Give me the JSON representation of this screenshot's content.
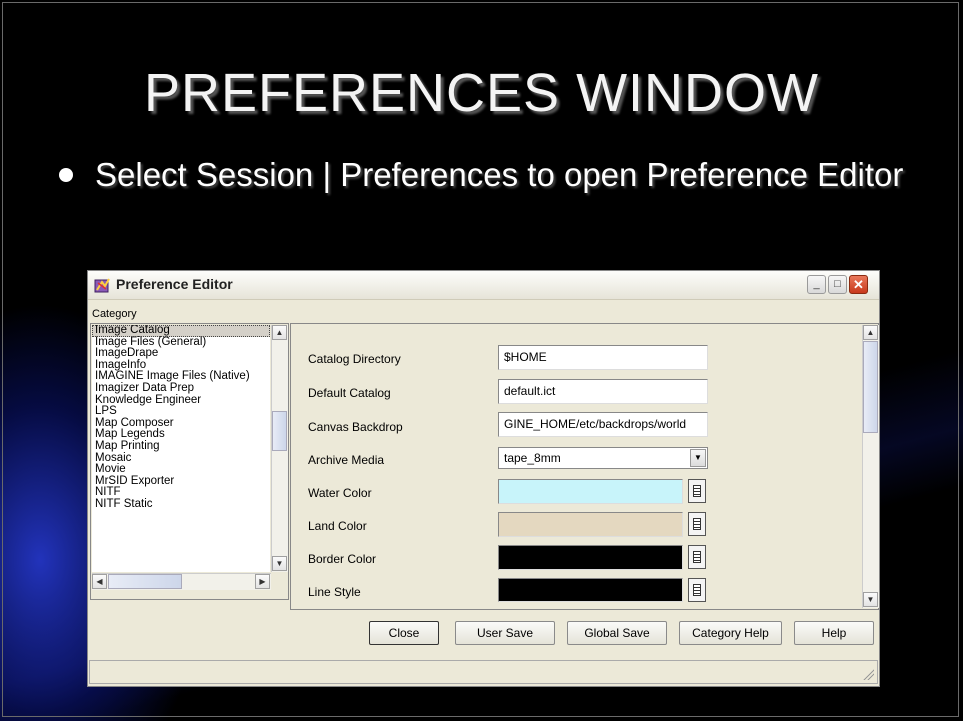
{
  "slide": {
    "title": "PREFERENCES WINDOW",
    "bullet": "Select Session | Preferences to open Preference Editor"
  },
  "window": {
    "title": "Preference Editor",
    "controls": {
      "minimize": "_",
      "maximize": "□",
      "close": "✕"
    }
  },
  "category": {
    "label": "Category",
    "selected": "Image Catalog",
    "items": [
      "Image Catalog",
      "Image Files (General)",
      "ImageDrape",
      "ImageInfo",
      "IMAGINE Image Files (Native)",
      "Imagizer Data Prep",
      "Knowledge Engineer",
      "LPS",
      "Map Composer",
      "Map Legends",
      "Map Printing",
      "Mosaic",
      "Movie",
      "MrSID Exporter",
      "NITF",
      "NITF Static"
    ]
  },
  "preferences": {
    "catalog_directory": {
      "label": "Catalog Directory",
      "value": "$HOME"
    },
    "default_catalog": {
      "label": "Default Catalog",
      "value": "default.ict"
    },
    "canvas_backdrop": {
      "label": "Canvas Backdrop",
      "value": "GINE_HOME/etc/backdrops/world"
    },
    "archive_media": {
      "label": "Archive Media",
      "value": "tape_8mm"
    },
    "water_color": {
      "label": "Water Color",
      "color": "#c8f4fa"
    },
    "land_color": {
      "label": "Land Color",
      "color": "#e4d8c0"
    },
    "border_color": {
      "label": "Border Color",
      "color": "#000000"
    },
    "line_style": {
      "label": "Line Style",
      "color": "#000000"
    }
  },
  "buttons": {
    "close": "Close",
    "user_save": "User Save",
    "global_save": "Global Save",
    "category_help": "Category Help",
    "help": "Help"
  },
  "icons": [
    "app-icon",
    "scroll-up-icon",
    "scroll-down-icon",
    "scroll-left-icon",
    "scroll-right-icon",
    "color-picker-icon",
    "dropdown-arrow-icon",
    "resize-grip-icon"
  ]
}
